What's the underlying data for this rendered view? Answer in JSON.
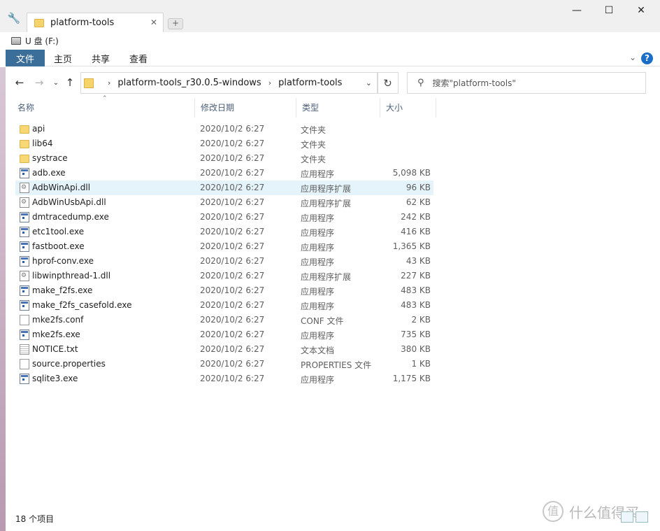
{
  "window": {
    "tab_title": "platform-tools",
    "tab_close": "✕",
    "newtab": "+",
    "minimize": "—",
    "maximize": "☐",
    "close": "✕"
  },
  "location": {
    "drive": "U 盘 (F:)"
  },
  "ribbon": {
    "file": "文件",
    "home": "主页",
    "share": "共享",
    "view": "查看"
  },
  "address": {
    "crumbs": [
      "platform-tools_r30.0.5-windows",
      "platform-tools"
    ],
    "search_placeholder": "搜索\"platform-tools\""
  },
  "columns": {
    "name": "名称",
    "date": "修改日期",
    "type": "类型",
    "size": "大小"
  },
  "files": [
    {
      "name": "api",
      "date": "2020/10/2 6:27",
      "type": "文件夹",
      "size": "",
      "icon": "folder-icon"
    },
    {
      "name": "lib64",
      "date": "2020/10/2 6:27",
      "type": "文件夹",
      "size": "",
      "icon": "folder-icon"
    },
    {
      "name": "systrace",
      "date": "2020/10/2 6:27",
      "type": "文件夹",
      "size": "",
      "icon": "folder-icon"
    },
    {
      "name": "adb.exe",
      "date": "2020/10/2 6:27",
      "type": "应用程序",
      "size": "5,098 KB",
      "icon": "exe-icon"
    },
    {
      "name": "AdbWinApi.dll",
      "date": "2020/10/2 6:27",
      "type": "应用程序扩展",
      "size": "96 KB",
      "icon": "dll-icon"
    },
    {
      "name": "AdbWinUsbApi.dll",
      "date": "2020/10/2 6:27",
      "type": "应用程序扩展",
      "size": "62 KB",
      "icon": "dll-icon"
    },
    {
      "name": "dmtracedump.exe",
      "date": "2020/10/2 6:27",
      "type": "应用程序",
      "size": "242 KB",
      "icon": "exe-icon"
    },
    {
      "name": "etc1tool.exe",
      "date": "2020/10/2 6:27",
      "type": "应用程序",
      "size": "416 KB",
      "icon": "exe-icon"
    },
    {
      "name": "fastboot.exe",
      "date": "2020/10/2 6:27",
      "type": "应用程序",
      "size": "1,365 KB",
      "icon": "exe-icon"
    },
    {
      "name": "hprof-conv.exe",
      "date": "2020/10/2 6:27",
      "type": "应用程序",
      "size": "43 KB",
      "icon": "exe-icon"
    },
    {
      "name": "libwinpthread-1.dll",
      "date": "2020/10/2 6:27",
      "type": "应用程序扩展",
      "size": "227 KB",
      "icon": "dll-icon"
    },
    {
      "name": "make_f2fs.exe",
      "date": "2020/10/2 6:27",
      "type": "应用程序",
      "size": "483 KB",
      "icon": "exe-icon"
    },
    {
      "name": "make_f2fs_casefold.exe",
      "date": "2020/10/2 6:27",
      "type": "应用程序",
      "size": "483 KB",
      "icon": "exe-icon"
    },
    {
      "name": "mke2fs.conf",
      "date": "2020/10/2 6:27",
      "type": "CONF 文件",
      "size": "2 KB",
      "icon": "document-icon"
    },
    {
      "name": "mke2fs.exe",
      "date": "2020/10/2 6:27",
      "type": "应用程序",
      "size": "735 KB",
      "icon": "exe-icon"
    },
    {
      "name": "NOTICE.txt",
      "date": "2020/10/2 6:27",
      "type": "文本文档",
      "size": "380 KB",
      "icon": "text-document-icon"
    },
    {
      "name": "source.properties",
      "date": "2020/10/2 6:27",
      "type": "PROPERTIES 文件",
      "size": "1 KB",
      "icon": "document-icon"
    },
    {
      "name": "sqlite3.exe",
      "date": "2020/10/2 6:27",
      "type": "应用程序",
      "size": "1,175 KB",
      "icon": "exe-icon"
    }
  ],
  "hovered_row": 4,
  "status": {
    "count": "18 个项目"
  },
  "watermark": {
    "logo": "值",
    "text": "什么值得买"
  },
  "colors": {
    "ribbon_file": "#3c6e9a",
    "selected_row": "#e5f3fb",
    "folder": "#f8d775",
    "header_text": "#4c607a"
  }
}
